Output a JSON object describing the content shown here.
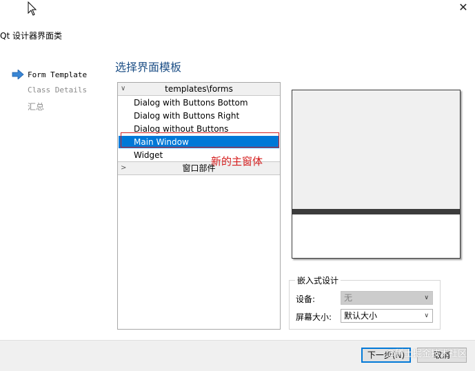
{
  "window": {
    "title": "Qt 设计器界面类"
  },
  "page_heading": "选择界面模板",
  "nav": {
    "items": [
      {
        "label": "Form Template",
        "active": true
      },
      {
        "label": "Class Details",
        "active": false
      },
      {
        "label": "汇总",
        "active": false
      }
    ]
  },
  "template_tree": {
    "group1": "templates\\forms",
    "items": [
      "Dialog with Buttons Bottom",
      "Dialog with Buttons Right",
      "Dialog without Buttons",
      "Main Window",
      "Widget"
    ],
    "selected": "Main Window",
    "group2": "窗口部件"
  },
  "annotation": "新的主窗体",
  "embedded_design": {
    "title": "嵌入式设计",
    "device_label": "设备:",
    "device_value": "无",
    "screen_label": "屏幕大小:",
    "screen_value": "默认大小"
  },
  "footer": {
    "next_label": "下一步(N)",
    "cancel_label": "取消"
  },
  "watermark": "@稀土掘金技术社区",
  "colors": {
    "selection": "#0078d7",
    "annotation": "#d41c1c",
    "heading": "#1d4f86"
  }
}
